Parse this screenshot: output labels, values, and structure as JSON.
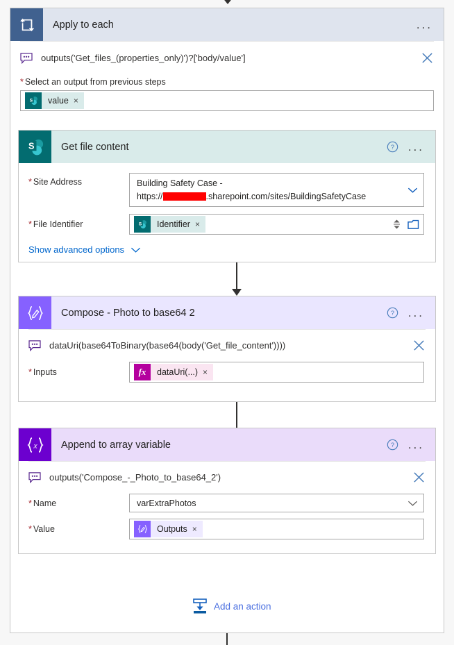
{
  "scope": {
    "title": "Apply to each",
    "icon": "loop-icon",
    "menu": "...",
    "expression": "outputs('Get_files_(properties_only)')?['body/value']",
    "expression_icon": "comment-icon",
    "close_icon": "close-icon",
    "field": {
      "label": "Select an output from previous steps",
      "required": "*",
      "token": {
        "text": "value",
        "icon": "sharepoint-icon",
        "remove": "×"
      }
    }
  },
  "actions": [
    {
      "id": "get-file-content",
      "title": "Get file content",
      "icon": "sharepoint-icon",
      "help": "?",
      "menu": "...",
      "fields": [
        {
          "label": "Site Address",
          "required": "*",
          "type": "dropdown",
          "line1": "Building Safety Case -",
          "line2_prefix": "https://",
          "line2_redacted": true,
          "line2_suffix": ".sharepoint.com/sites/BuildingSafetyCase",
          "chevron": "chevron-down-icon"
        },
        {
          "label": "File Identifier",
          "required": "*",
          "type": "token",
          "token": {
            "text": "Identifier",
            "icon": "sharepoint-icon",
            "remove": "×"
          },
          "spinner": "spinner-icon",
          "picker": "folder-picker-icon"
        }
      ],
      "advanced_link": "Show advanced options",
      "advanced_chevron": "chevron-down-icon"
    },
    {
      "id": "compose-photo-to-base64-2",
      "title": "Compose - Photo to base64 2",
      "icon": "compose-icon",
      "help": "?",
      "menu": "...",
      "expression": "dataUri(base64ToBinary(base64(body('Get_file_content'))))",
      "expression_icon": "comment-icon",
      "close_icon": "close-icon",
      "fields": [
        {
          "label": "Inputs",
          "required": "*",
          "type": "token",
          "token": {
            "text": "dataUri(...)",
            "icon": "fx-icon",
            "remove": "×"
          }
        }
      ]
    },
    {
      "id": "append-to-array-variable",
      "title": "Append to array variable",
      "icon": "variable-icon",
      "help": "?",
      "menu": "...",
      "expression": "outputs('Compose_-_Photo_to_base64_2')",
      "expression_icon": "comment-icon",
      "close_icon": "close-icon",
      "fields": [
        {
          "label": "Name",
          "required": "*",
          "type": "dropdown",
          "value": "varExtraPhotos",
          "chevron": "chevron-down-icon"
        },
        {
          "label": "Value",
          "required": "*",
          "type": "token",
          "token": {
            "text": "Outputs",
            "icon": "compose-icon",
            "remove": "×"
          }
        }
      ]
    }
  ],
  "add_action": {
    "label": "Add an action",
    "icon": "add-action-icon"
  },
  "colors": {
    "scope_header": "#dfe4ee",
    "scope_icon": "#40618f",
    "sharepoint": "#036c70",
    "sharepoint_header": "#d9ebea",
    "compose": "#8661ff",
    "compose_header": "#eae6ff",
    "variable": "#6c00cf",
    "variable_header": "#eadcfa",
    "fx": "#b4009e",
    "link": "#0066cc",
    "required": "#a4262c",
    "redaction": "#ff0000"
  }
}
